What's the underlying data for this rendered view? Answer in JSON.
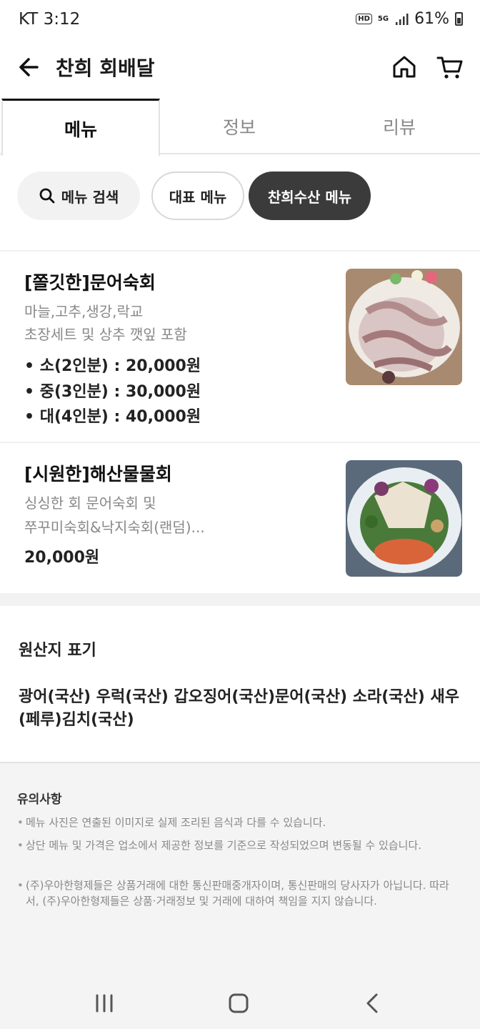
{
  "status_bar": {
    "carrier": "KT 3:12",
    "hd": "HD",
    "network": "5G",
    "battery": "61%"
  },
  "header": {
    "title": "찬희 회배달",
    "back_icon": "arrow-left-icon",
    "home_icon": "home-icon",
    "cart_icon": "cart-icon"
  },
  "tabs": [
    {
      "label": "메뉴",
      "active": true
    },
    {
      "label": "정보",
      "active": false
    },
    {
      "label": "리뷰",
      "active": false
    }
  ],
  "chips": {
    "search": "메뉴 검색",
    "representative": "대표 메뉴",
    "selected": "찬희수산 메뉴"
  },
  "menu_items": [
    {
      "name": "[쫄깃한]문어숙회",
      "desc1": "마늘,고추,생강,락교",
      "desc2": "초장세트 및 상추 깻잎 포함",
      "prices": [
        "• 소(2인분) : 20,000원",
        "• 중(3인분) : 30,000원",
        "• 대(4인분) : 40,000원"
      ]
    },
    {
      "name": "[시원한]해산물물회",
      "desc1": "싱싱한 회 문어숙회 및",
      "desc2": "쭈꾸미숙회&낙지숙회(랜덤)...",
      "price": "20,000원"
    }
  ],
  "origin": {
    "title": "원산지 표기",
    "text": "광어(국산) 우럭(국산) 갑오징어(국산)문어(국산) 소라(국산) 새우(페루)김치(국산)"
  },
  "notice": {
    "title": "유의사항",
    "items": [
      "메뉴 사진은 연출된 이미지로 실제 조리된 음식과 다를 수 있습니다.",
      "상단 메뉴 및 가격은 업소에서 제공한 정보를 기준으로 작성되었으며 변동될 수 있습니다.",
      "(주)우아한형제들은 상품거래에 대한 통신판매중개자이며, 통신판매의 당사자가 아닙니다. 따라서, (주)우아한형제들은 상품·거래정보 및 거래에 대하여 책임을 지지 않습니다."
    ]
  },
  "nav_bar": {
    "recents_icon": "recents-icon",
    "home_icon": "nav-home-icon",
    "back_icon": "nav-back-icon"
  }
}
